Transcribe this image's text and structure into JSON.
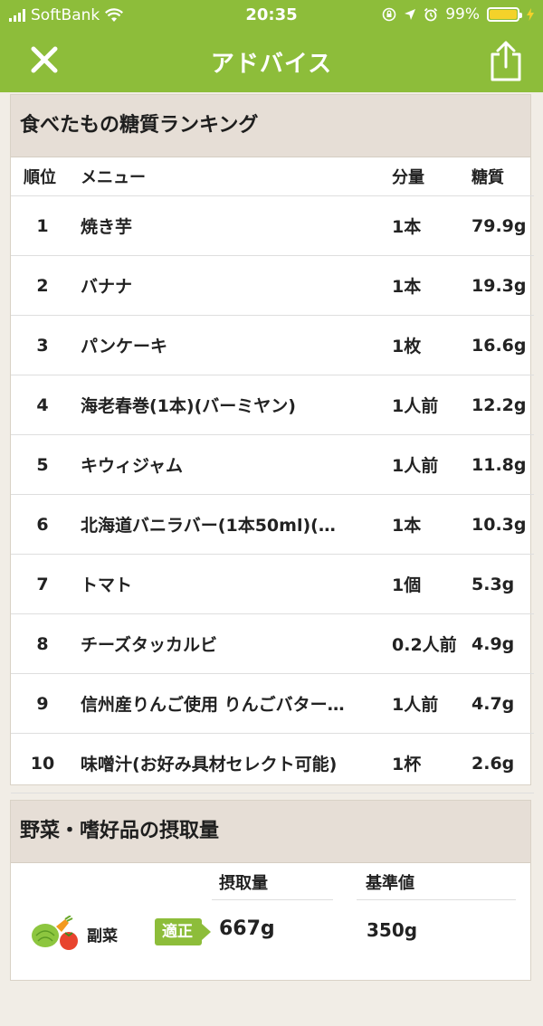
{
  "status_bar": {
    "carrier": "SoftBank",
    "time": "20:35",
    "battery": "99%",
    "battery_level": 0.99
  },
  "nav": {
    "title": "アドバイス"
  },
  "ranking": {
    "title": "食べたもの糖質ランキング",
    "headers": {
      "rank": "順位",
      "menu": "メニュー",
      "qty": "分量",
      "carb": "糖質"
    },
    "rows": [
      {
        "rank": "1",
        "menu": "焼き芋",
        "qty": "1本",
        "carb": "79.9g"
      },
      {
        "rank": "2",
        "menu": "バナナ",
        "qty": "1本",
        "carb": "19.3g"
      },
      {
        "rank": "3",
        "menu": "パンケーキ",
        "qty": "1枚",
        "carb": "16.6g"
      },
      {
        "rank": "4",
        "menu": "海老春巻(1本)(バーミヤン)",
        "qty": "1人前",
        "carb": "12.2g"
      },
      {
        "rank": "5",
        "menu": "キウィジャム",
        "qty": "1人前",
        "carb": "11.8g"
      },
      {
        "rank": "6",
        "menu": "北海道バニラバー(1本50ml)(…",
        "qty": "1本",
        "carb": "10.3g"
      },
      {
        "rank": "7",
        "menu": "トマト",
        "qty": "1個",
        "carb": "5.3g"
      },
      {
        "rank": "8",
        "menu": "チーズタッカルビ",
        "qty": "0.2人前",
        "carb": "4.9g"
      },
      {
        "rank": "9",
        "menu": "信州産りんご使用 りんごバター…",
        "qty": "1人前",
        "carb": "4.7g"
      },
      {
        "rank": "10",
        "menu": "味噌汁(お好み具材セレクト可能)",
        "qty": "1杯",
        "carb": "2.6g"
      }
    ]
  },
  "intake": {
    "title": "野菜・嗜好品の摂取量",
    "headers": {
      "amount": "摂取量",
      "standard": "基準値"
    },
    "rows": [
      {
        "category": "副菜",
        "badge": "適正",
        "amount": "667g",
        "standard": "350g"
      }
    ]
  },
  "colors": {
    "accent": "#8dbd3a",
    "header_bg": "#e6ded6",
    "page_bg": "#f1ede6"
  },
  "icons": {
    "close": "close-icon",
    "share": "share-icon",
    "vegetables": "vegetables-icon"
  }
}
